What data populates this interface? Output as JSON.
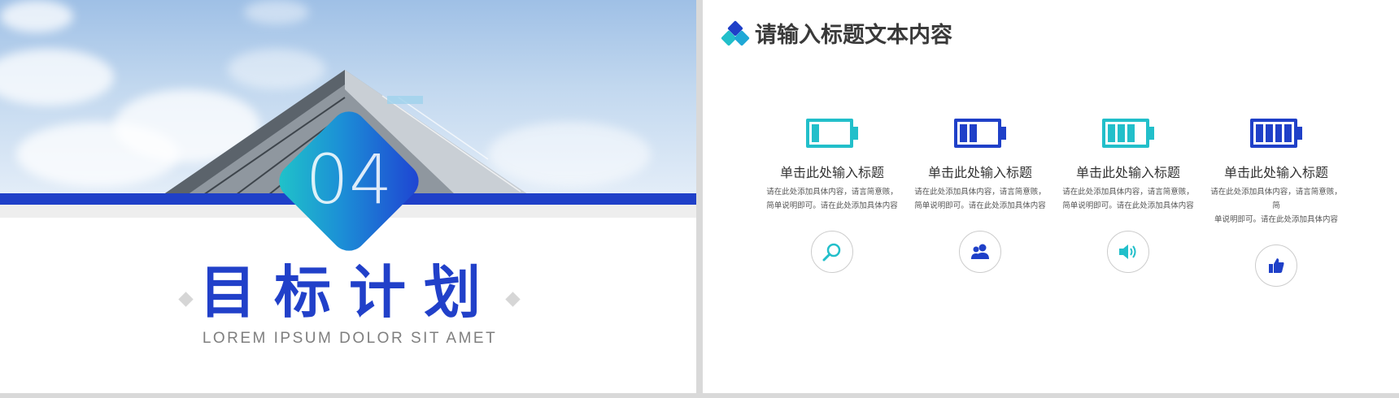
{
  "left_slide": {
    "section_number": "04",
    "title": "目标计划",
    "subtitle": "LOREM IPSUM DOLOR SIT AMET"
  },
  "right_slide": {
    "heading": "请输入标题文本内容",
    "cards": [
      {
        "title": "单击此处输入标题",
        "desc_line1": "请在此处添加具体内容，请言简意赅，",
        "desc_line2": "简单说明即可。请在此处添加具体内容",
        "icon": "search-icon",
        "battery_fill": 1,
        "color": "#22bfca"
      },
      {
        "title": "单击此处输入标题",
        "desc_line1": "请在此处添加具体内容，请言简意赅，",
        "desc_line2": "简单说明即可。请在此处添加具体内容",
        "icon": "users-icon",
        "battery_fill": 2,
        "color": "#1f40c8"
      },
      {
        "title": "单击此处输入标题",
        "desc_line1": "请在此处添加具体内容，请言简意赅，",
        "desc_line2": "简单说明即可。请在此处添加具体内容",
        "icon": "speaker-icon",
        "battery_fill": 3,
        "color": "#22bfca"
      },
      {
        "title": "单击此处输入标题",
        "desc_line1": "请在此处添加具体内容，请言简意赅，简",
        "desc_line2": "单说明即可。请在此处添加具体内容",
        "icon": "thumbs-up-icon",
        "battery_fill": 4,
        "color": "#1f40c8"
      }
    ]
  },
  "colors": {
    "blue": "#1f40c8",
    "cyan": "#22bfca",
    "grey_text": "#7f7f7f"
  }
}
